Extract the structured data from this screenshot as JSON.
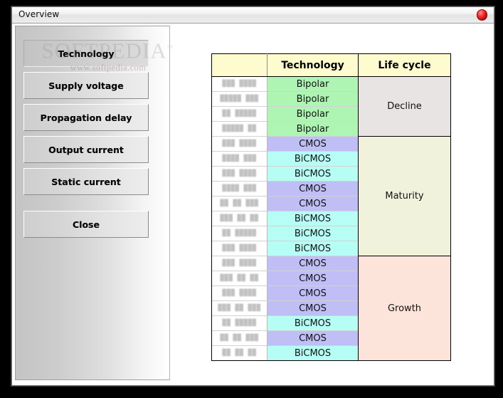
{
  "window": {
    "title": "Overview",
    "close_icon": "close-icon"
  },
  "sidebar": {
    "buttons": [
      {
        "label": "Technology",
        "active": true
      },
      {
        "label": "Supply voltage",
        "active": false
      },
      {
        "label": "Propagation delay",
        "active": false
      },
      {
        "label": "Output current",
        "active": false
      },
      {
        "label": "Static current",
        "active": false
      },
      {
        "label": "Close",
        "active": false
      }
    ]
  },
  "watermark": {
    "main": "SOFTPEDIA",
    "trademark": "™",
    "sub": "www.softpedia.com"
  },
  "table": {
    "headers": [
      "",
      "Technology",
      "Life cycle"
    ],
    "colors": {
      "header_bg": "#fefccf",
      "bipolar": "#aef5b4",
      "cmos": "#bfbff5",
      "bicmos": "#b6fdf6",
      "decline": "#e8e4e3",
      "maturity": "#f0f2dc",
      "growth": "#fde4da"
    },
    "rows": [
      {
        "part": "███ ████",
        "technology": "Bipolar"
      },
      {
        "part": "█████ ███",
        "technology": "Bipolar"
      },
      {
        "part": "██ █████",
        "technology": "Bipolar"
      },
      {
        "part": "█████ ██",
        "technology": "Bipolar"
      },
      {
        "part": "███ ████",
        "technology": "CMOS"
      },
      {
        "part": "████ ███",
        "technology": "BiCMOS"
      },
      {
        "part": "███ ████",
        "technology": "BiCMOS"
      },
      {
        "part": "████ ███",
        "technology": "CMOS"
      },
      {
        "part": "██ ██ ███",
        "technology": "CMOS"
      },
      {
        "part": "███ ██ ██",
        "technology": "BiCMOS"
      },
      {
        "part": "██ █████",
        "technology": "BiCMOS"
      },
      {
        "part": "███ ████",
        "technology": "BiCMOS"
      },
      {
        "part": "███ ████",
        "technology": "CMOS"
      },
      {
        "part": "███ ██ ██",
        "technology": "CMOS"
      },
      {
        "part": "███ ████",
        "technology": "CMOS"
      },
      {
        "part": "███ ██ ███",
        "technology": "CMOS"
      },
      {
        "part": "██ █████",
        "technology": "BiCMOS"
      },
      {
        "part": "██ ██ ███",
        "technology": "CMOS"
      },
      {
        "part": "██ ██ ██",
        "technology": "BiCMOS"
      }
    ],
    "life_cycle_groups": [
      {
        "label": "Decline",
        "rows": 4
      },
      {
        "label": "Maturity",
        "rows": 8
      },
      {
        "label": "Growth",
        "rows": 7
      }
    ]
  }
}
